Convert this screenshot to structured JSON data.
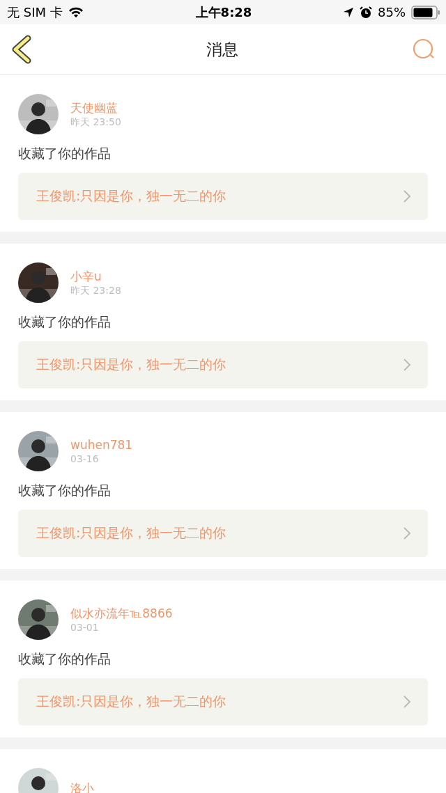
{
  "status_bar": {
    "carrier": "无 SIM 卡",
    "time": "上午8:28",
    "battery": "85%"
  },
  "nav": {
    "title": "消息"
  },
  "messages": [
    {
      "name": "天使幽蓝",
      "time": "昨天 23:50",
      "action": "收藏了你的作品",
      "work": "王俊凯:只因是你，独一无二的你"
    },
    {
      "name": "小辛u",
      "time": "昨天 23:28",
      "action": "收藏了你的作品",
      "work": "王俊凯:只因是你，独一无二的你"
    },
    {
      "name": "wuhen781",
      "time": "03-16",
      "action": "收藏了你的作品",
      "work": "王俊凯:只因是你，独一无二的你"
    },
    {
      "name": "似水亦流年℡8866",
      "time": "03-01",
      "action": "收藏了你的作品",
      "work": "王俊凯:只因是你，独一无二的你"
    },
    {
      "name": "洛小"
    }
  ]
}
